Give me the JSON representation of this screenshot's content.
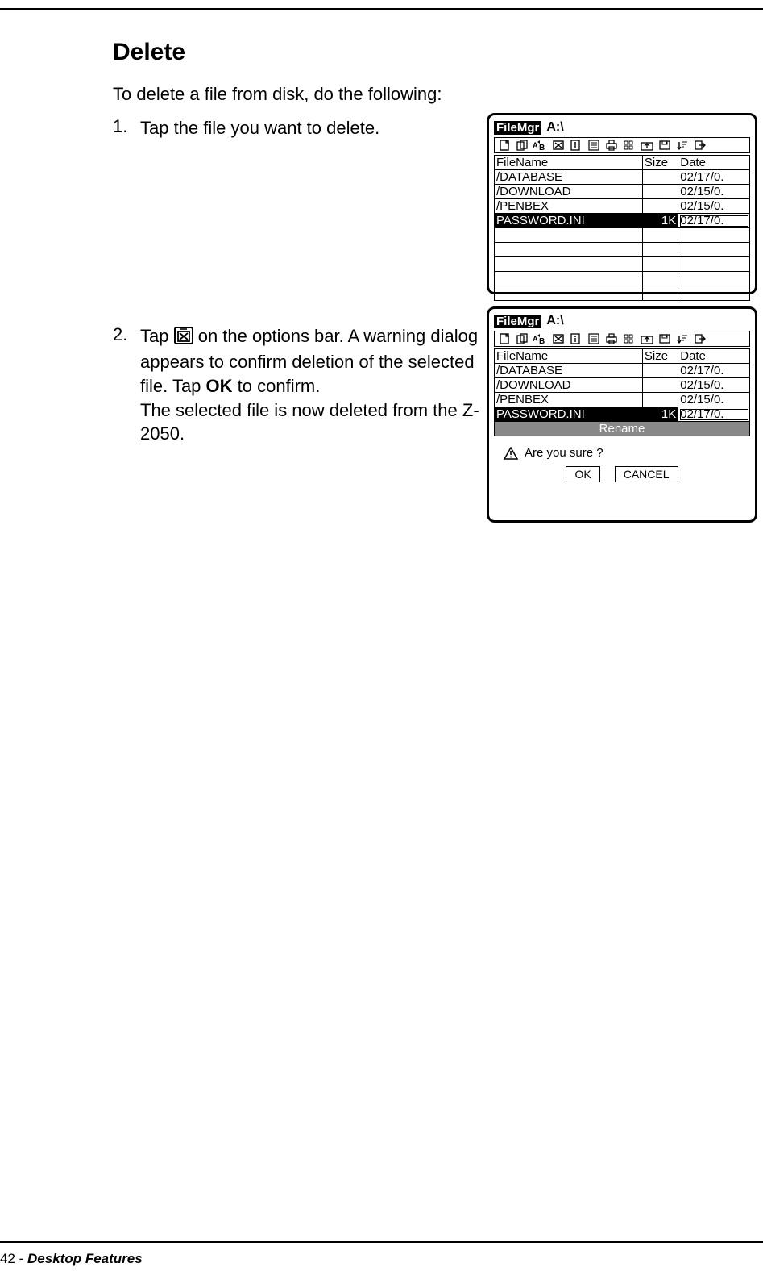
{
  "page": {
    "title": "Delete",
    "intro": "To delete a file from disk, do the following:",
    "footer_page": "42",
    "footer_sep": "  -  ",
    "footer_section": "Desktop Features"
  },
  "steps": [
    {
      "num": "1.",
      "text": "Tap the file you want to delete."
    },
    {
      "num": "2.",
      "text_before": "Tap ",
      "text_after": " on the options bar. A warning dialog appears to confirm deletion of the selected file. Tap ",
      "bold_word": "OK",
      "text_after2": " to confirm.",
      "line2": "The selected file is now deleted from the Z-2050."
    }
  ],
  "filemgr": {
    "app_name": "FileMgr",
    "path": "A:\\",
    "columns": {
      "name": "FileName",
      "size": "Size",
      "date": "Date"
    },
    "rows": [
      {
        "name": "/DATABASE",
        "size": "",
        "date": "02/17/0."
      },
      {
        "name": "/DOWNLOAD",
        "size": "",
        "date": "02/15/0."
      },
      {
        "name": "/PENBEX",
        "size": "",
        "date": "02/15/0."
      },
      {
        "name": "PASSWORD.INI",
        "size": "1K",
        "date": "02/17/0.",
        "selected": true
      }
    ],
    "blank_rows_shot1": 5
  },
  "dialog": {
    "banner": "Rename",
    "message": "Are you sure ?",
    "ok": "OK",
    "cancel": "CANCEL"
  }
}
